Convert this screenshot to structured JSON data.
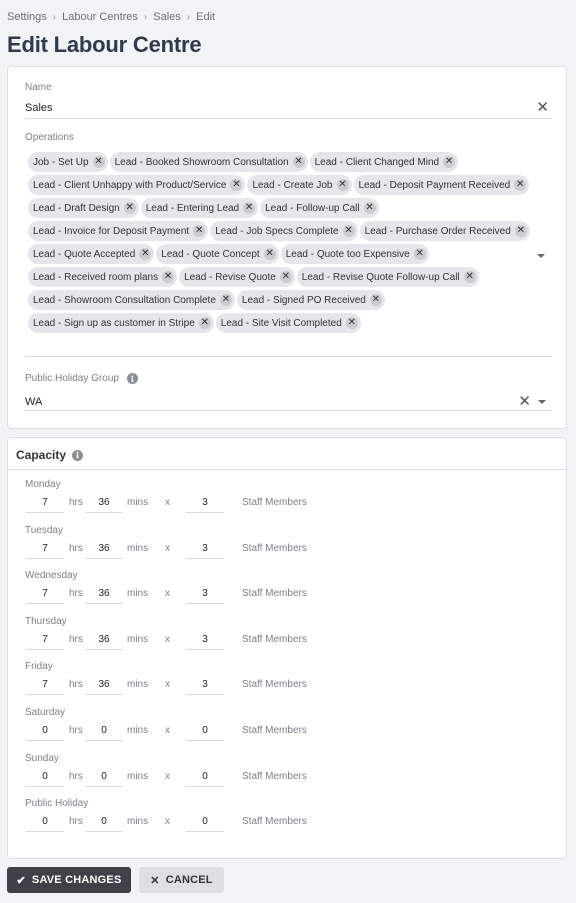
{
  "breadcrumb": [
    "Settings",
    "Labour Centres",
    "Sales",
    "Edit"
  ],
  "page_title": "Edit Labour Centre",
  "name_field": {
    "label": "Name",
    "value": "Sales"
  },
  "operations": {
    "label": "Operations",
    "chips": [
      "Job - Set Up",
      "Lead - Booked Showroom Consultation",
      "Lead - Client Changed Mind",
      "Lead - Client Unhappy with Product/Service",
      "Lead - Create Job",
      "Lead - Deposit Payment Received",
      "Lead - Draft Design",
      "Lead - Entering Lead",
      "Lead - Follow-up Call",
      "Lead - Invoice for Deposit Payment",
      "Lead - Job Specs Complete",
      "Lead - Purchase Order Received",
      "Lead - Quote Accepted",
      "Lead - Quote Concept",
      "Lead - Quote too Expensive",
      "Lead - Received room plans",
      "Lead - Revise Quote",
      "Lead - Revise Quote Follow-up Call",
      "Lead - Showroom Consultation Complete",
      "Lead - Signed PO Received",
      "Lead - Sign up as customer in Stripe",
      "Lead - Site Visit Completed"
    ]
  },
  "public_holiday_group": {
    "label": "Public Holiday Group",
    "value": "WA"
  },
  "capacity": {
    "title": "Capacity",
    "units": {
      "hrs": "hrs",
      "mins": "mins",
      "x": "x",
      "staff": "Staff Members"
    },
    "days": [
      {
        "name": "Monday",
        "hrs": "7",
        "mins": "36",
        "staff": "3"
      },
      {
        "name": "Tuesday",
        "hrs": "7",
        "mins": "36",
        "staff": "3"
      },
      {
        "name": "Wednesday",
        "hrs": "7",
        "mins": "36",
        "staff": "3"
      },
      {
        "name": "Thursday",
        "hrs": "7",
        "mins": "36",
        "staff": "3"
      },
      {
        "name": "Friday",
        "hrs": "7",
        "mins": "36",
        "staff": "3"
      },
      {
        "name": "Saturday",
        "hrs": "0",
        "mins": "0",
        "staff": "0"
      },
      {
        "name": "Sunday",
        "hrs": "0",
        "mins": "0",
        "staff": "0"
      },
      {
        "name": "Public Holiday",
        "hrs": "0",
        "mins": "0",
        "staff": "0"
      }
    ]
  },
  "actions": {
    "save": "SAVE CHANGES",
    "cancel": "CANCEL"
  },
  "colors": {
    "title": "#2e3a4e",
    "save_bg": "#3e4147",
    "chip_bg": "#e5e6e9",
    "cancel_bg": "#dddfe3"
  },
  "icons": {
    "clear": "close-icon",
    "dropdown": "chevron-down-icon",
    "info": "info-icon",
    "save": "check-icon",
    "cancel": "close-icon"
  }
}
